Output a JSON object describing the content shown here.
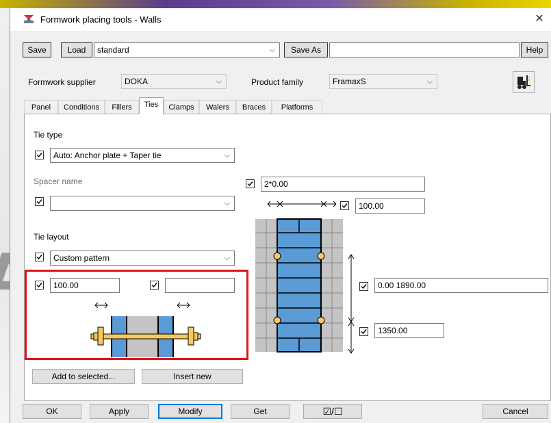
{
  "window": {
    "title": "Formwork placing tools - Walls",
    "close": "✕"
  },
  "toolbar": {
    "save": "Save",
    "load": "Load",
    "preset": "standard",
    "save_as": "Save As",
    "save_as_name": "",
    "help": "Help"
  },
  "supplier": {
    "label": "Formwork supplier",
    "value": "DOKA",
    "family_label": "Product family",
    "family_value": "FramaxS"
  },
  "tabs": [
    "Panel",
    "Conditions",
    "Fillers",
    "Ties",
    "Clamps",
    "Walers",
    "Braces",
    "Platforms"
  ],
  "active_tab": "Ties",
  "ties": {
    "tie_type_label": "Tie type",
    "tie_type_value": "Auto: Anchor plate + Taper tie",
    "spacer_label": "Spacer name",
    "spacer_value": "",
    "spacer_dims": "2*0.00",
    "edge_offset": "100.00",
    "layout_label": "Tie layout",
    "layout_value": "Custom pattern",
    "left_offset": "100.00",
    "right_offset": "",
    "vertical_positions": "0.00 1890.00",
    "vertical_spacing": "1350.00",
    "add_selected": "Add to selected...",
    "insert_new": "Insert new"
  },
  "footer": {
    "ok": "OK",
    "apply": "Apply",
    "modify": "Modify",
    "get": "Get",
    "toggle": "☑/☐",
    "cancel": "Cancel"
  },
  "colors": {
    "accent": "#0078d7",
    "highlight": "#e0141c",
    "panel_blue": "#5b9bd5",
    "tie_yellow": "#f6c85f"
  }
}
